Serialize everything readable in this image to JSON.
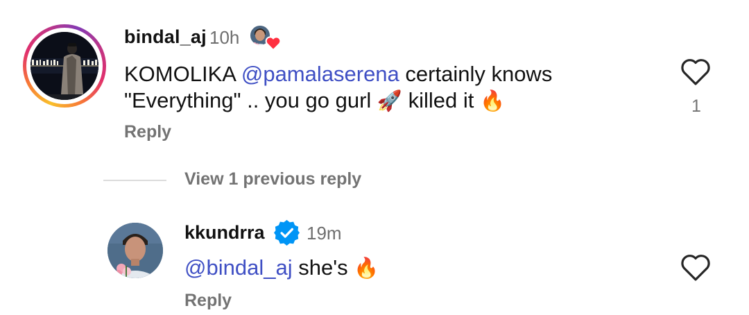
{
  "comments": [
    {
      "username": "bindal_aj",
      "time": "10h",
      "text_prefix": "KOMOLIKA ",
      "mention_symbol": "@",
      "mention": "pamalaserena",
      "text_line1_rest": " certainly knows",
      "text_line2": "\"Everything\" .. you go gurl ",
      "emoji_rocket": "🚀",
      "text_after_rocket": " killed it ",
      "emoji_fire": "🔥",
      "reply_label": "Reply",
      "like_count": "1",
      "has_story_ring": true,
      "liked_by_author_icon": "author-avatar-with-heart-icon"
    },
    {
      "username": "kkundrra",
      "verified": true,
      "time": "19m",
      "mention_symbol": "@",
      "mention": "bindal_aj",
      "text_rest": " she's ",
      "emoji_fire": "🔥",
      "reply_label": "Reply"
    }
  ],
  "thread": {
    "view_previous_label": "View 1 previous reply"
  },
  "icons": {
    "like": "heart-outline-icon",
    "verified": "verified-badge-icon"
  },
  "colors": {
    "mention": "#3f4fc4",
    "secondary_text": "#737373",
    "verified_blue": "#0095f6",
    "liked_heart": "#ff3040"
  }
}
